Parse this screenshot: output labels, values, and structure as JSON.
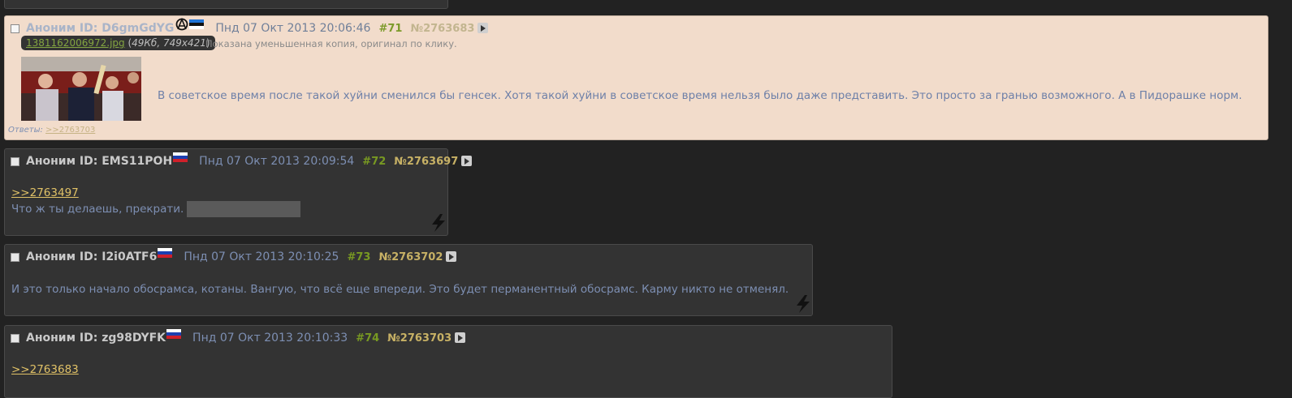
{
  "posts": [
    {
      "name": "Аноним ID: D6gmGdYG",
      "date": "Пнд 07 Окт 2013 20:06:46",
      "num": "#71",
      "id": "№2763683",
      "file": {
        "name": "1381162006972.jpg",
        "meta": "49Кб, 749x421"
      },
      "thumb_note": "Показана уменьшенная копия, оригинал по клику.",
      "text": "В советское время после такой хуйни сменился бы генсек. Хотя такой хуйни в советское время нельзя было даже представить. Это просто за гранью возможного. А в Пидорашке норм.",
      "answers_label": "Ответы:",
      "answers_ref": ">>2763703"
    },
    {
      "name": "Аноним ID: EMS11POH",
      "date": "Пнд 07 Окт 2013 20:09:54",
      "num": "#72",
      "id": "№2763697",
      "ref": ">>2763497",
      "text": "Что ж ты делаешь, прекрати."
    },
    {
      "name": "Аноним ID: I2i0ATF6",
      "date": "Пнд 07 Окт 2013 20:10:25",
      "num": "#73",
      "id": "№2763702",
      "text": "И это только начало обосрамса, котаны. Вангую, что всё еще впереди. Это будет перманентный обосрамс. Карму никто не отменял."
    },
    {
      "name": "Аноним ID: zg98DYFK",
      "date": "Пнд 07 Окт 2013 20:10:33",
      "num": "#74",
      "id": "№2763703",
      "ref": ">>2763683"
    }
  ]
}
